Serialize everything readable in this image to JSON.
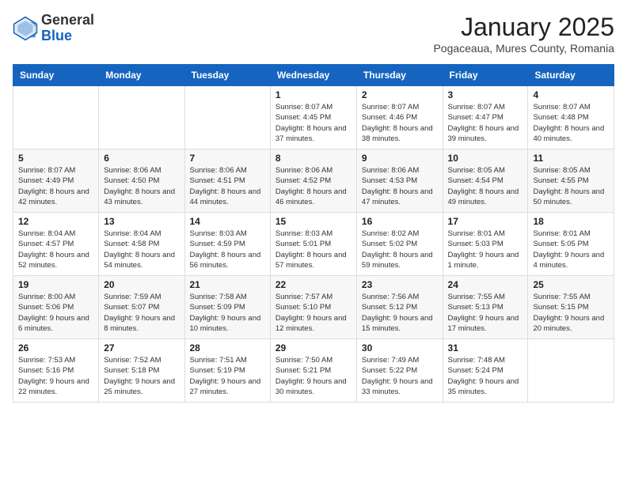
{
  "logo": {
    "general": "General",
    "blue": "Blue"
  },
  "header": {
    "month": "January 2025",
    "location": "Pogaceaua, Mures County, Romania"
  },
  "weekdays": [
    "Sunday",
    "Monday",
    "Tuesday",
    "Wednesday",
    "Thursday",
    "Friday",
    "Saturday"
  ],
  "weeks": [
    [
      {
        "day": "",
        "info": ""
      },
      {
        "day": "",
        "info": ""
      },
      {
        "day": "",
        "info": ""
      },
      {
        "day": "1",
        "info": "Sunrise: 8:07 AM\nSunset: 4:45 PM\nDaylight: 8 hours and 37 minutes."
      },
      {
        "day": "2",
        "info": "Sunrise: 8:07 AM\nSunset: 4:46 PM\nDaylight: 8 hours and 38 minutes."
      },
      {
        "day": "3",
        "info": "Sunrise: 8:07 AM\nSunset: 4:47 PM\nDaylight: 8 hours and 39 minutes."
      },
      {
        "day": "4",
        "info": "Sunrise: 8:07 AM\nSunset: 4:48 PM\nDaylight: 8 hours and 40 minutes."
      }
    ],
    [
      {
        "day": "5",
        "info": "Sunrise: 8:07 AM\nSunset: 4:49 PM\nDaylight: 8 hours and 42 minutes."
      },
      {
        "day": "6",
        "info": "Sunrise: 8:06 AM\nSunset: 4:50 PM\nDaylight: 8 hours and 43 minutes."
      },
      {
        "day": "7",
        "info": "Sunrise: 8:06 AM\nSunset: 4:51 PM\nDaylight: 8 hours and 44 minutes."
      },
      {
        "day": "8",
        "info": "Sunrise: 8:06 AM\nSunset: 4:52 PM\nDaylight: 8 hours and 46 minutes."
      },
      {
        "day": "9",
        "info": "Sunrise: 8:06 AM\nSunset: 4:53 PM\nDaylight: 8 hours and 47 minutes."
      },
      {
        "day": "10",
        "info": "Sunrise: 8:05 AM\nSunset: 4:54 PM\nDaylight: 8 hours and 49 minutes."
      },
      {
        "day": "11",
        "info": "Sunrise: 8:05 AM\nSunset: 4:55 PM\nDaylight: 8 hours and 50 minutes."
      }
    ],
    [
      {
        "day": "12",
        "info": "Sunrise: 8:04 AM\nSunset: 4:57 PM\nDaylight: 8 hours and 52 minutes."
      },
      {
        "day": "13",
        "info": "Sunrise: 8:04 AM\nSunset: 4:58 PM\nDaylight: 8 hours and 54 minutes."
      },
      {
        "day": "14",
        "info": "Sunrise: 8:03 AM\nSunset: 4:59 PM\nDaylight: 8 hours and 56 minutes."
      },
      {
        "day": "15",
        "info": "Sunrise: 8:03 AM\nSunset: 5:01 PM\nDaylight: 8 hours and 57 minutes."
      },
      {
        "day": "16",
        "info": "Sunrise: 8:02 AM\nSunset: 5:02 PM\nDaylight: 8 hours and 59 minutes."
      },
      {
        "day": "17",
        "info": "Sunrise: 8:01 AM\nSunset: 5:03 PM\nDaylight: 9 hours and 1 minute."
      },
      {
        "day": "18",
        "info": "Sunrise: 8:01 AM\nSunset: 5:05 PM\nDaylight: 9 hours and 4 minutes."
      }
    ],
    [
      {
        "day": "19",
        "info": "Sunrise: 8:00 AM\nSunset: 5:06 PM\nDaylight: 9 hours and 6 minutes."
      },
      {
        "day": "20",
        "info": "Sunrise: 7:59 AM\nSunset: 5:07 PM\nDaylight: 9 hours and 8 minutes."
      },
      {
        "day": "21",
        "info": "Sunrise: 7:58 AM\nSunset: 5:09 PM\nDaylight: 9 hours and 10 minutes."
      },
      {
        "day": "22",
        "info": "Sunrise: 7:57 AM\nSunset: 5:10 PM\nDaylight: 9 hours and 12 minutes."
      },
      {
        "day": "23",
        "info": "Sunrise: 7:56 AM\nSunset: 5:12 PM\nDaylight: 9 hours and 15 minutes."
      },
      {
        "day": "24",
        "info": "Sunrise: 7:55 AM\nSunset: 5:13 PM\nDaylight: 9 hours and 17 minutes."
      },
      {
        "day": "25",
        "info": "Sunrise: 7:55 AM\nSunset: 5:15 PM\nDaylight: 9 hours and 20 minutes."
      }
    ],
    [
      {
        "day": "26",
        "info": "Sunrise: 7:53 AM\nSunset: 5:16 PM\nDaylight: 9 hours and 22 minutes."
      },
      {
        "day": "27",
        "info": "Sunrise: 7:52 AM\nSunset: 5:18 PM\nDaylight: 9 hours and 25 minutes."
      },
      {
        "day": "28",
        "info": "Sunrise: 7:51 AM\nSunset: 5:19 PM\nDaylight: 9 hours and 27 minutes."
      },
      {
        "day": "29",
        "info": "Sunrise: 7:50 AM\nSunset: 5:21 PM\nDaylight: 9 hours and 30 minutes."
      },
      {
        "day": "30",
        "info": "Sunrise: 7:49 AM\nSunset: 5:22 PM\nDaylight: 9 hours and 33 minutes."
      },
      {
        "day": "31",
        "info": "Sunrise: 7:48 AM\nSunset: 5:24 PM\nDaylight: 9 hours and 35 minutes."
      },
      {
        "day": "",
        "info": ""
      }
    ]
  ]
}
